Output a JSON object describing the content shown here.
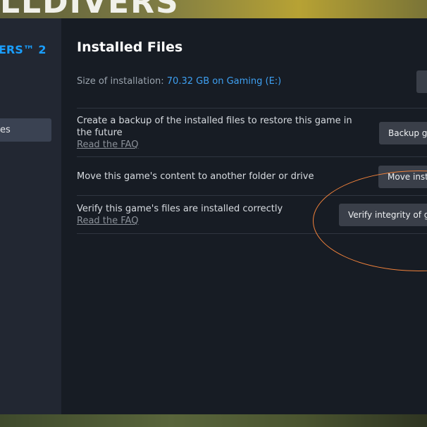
{
  "banner": {
    "text": "LLDIVERS"
  },
  "sidebar": {
    "game_title": "ERS™ 2",
    "items": [
      {
        "label": "es"
      }
    ]
  },
  "main": {
    "title": "Installed Files",
    "size_label": "Size of installation: ",
    "size_value": "70.32 GB on Gaming (E:)",
    "rows": [
      {
        "text": "Create a backup of the installed files to restore this game in the future",
        "link": "Read the FAQ",
        "button": "Backup ga"
      },
      {
        "text": "Move this game's content to another folder or drive",
        "button": "Move insta"
      },
      {
        "text": "Verify this game's files are installed correctly",
        "link": "Read the FAQ",
        "button": "Verify integrity of ga"
      }
    ]
  },
  "colors": {
    "accent": "#1a9fff",
    "annotation": "#f2823b"
  },
  "icons": {
    "folder_button": "browse-folder-icon"
  }
}
